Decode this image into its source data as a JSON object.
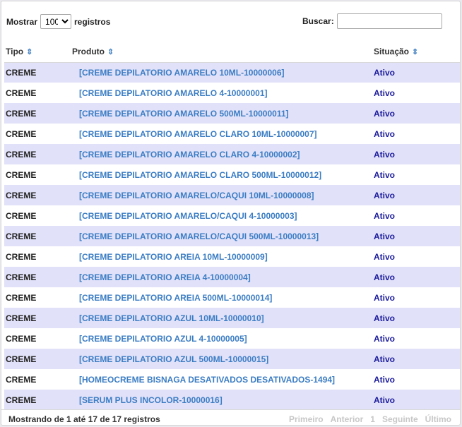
{
  "controls": {
    "show_label": "Mostrar",
    "page_size": "100",
    "records_label": "registros",
    "search_label": "Buscar:",
    "search_value": ""
  },
  "table": {
    "headers": {
      "tipo": "Tipo",
      "produto": "Produto",
      "situacao": "Situação"
    },
    "rows": [
      {
        "tipo": "CREME",
        "produto": "[CREME DEPILATORIO AMARELO 10ML-10000006]",
        "situacao": "Ativo"
      },
      {
        "tipo": "CREME",
        "produto": "[CREME DEPILATORIO AMARELO 4-10000001]",
        "situacao": "Ativo"
      },
      {
        "tipo": "CREME",
        "produto": "[CREME DEPILATORIO AMARELO 500ML-10000011]",
        "situacao": "Ativo"
      },
      {
        "tipo": "CREME",
        "produto": "[CREME DEPILATORIO AMARELO CLARO 10ML-10000007]",
        "situacao": "Ativo"
      },
      {
        "tipo": "CREME",
        "produto": "[CREME DEPILATORIO AMARELO CLARO 4-10000002]",
        "situacao": "Ativo"
      },
      {
        "tipo": "CREME",
        "produto": "[CREME DEPILATORIO AMARELO CLARO 500ML-10000012]",
        "situacao": "Ativo"
      },
      {
        "tipo": "CREME",
        "produto": "[CREME DEPILATORIO AMARELO/CAQUI 10ML-10000008]",
        "situacao": "Ativo"
      },
      {
        "tipo": "CREME",
        "produto": "[CREME DEPILATORIO AMARELO/CAQUI 4-10000003]",
        "situacao": "Ativo"
      },
      {
        "tipo": "CREME",
        "produto": "[CREME DEPILATORIO AMARELO/CAQUI 500ML-10000013]",
        "situacao": "Ativo"
      },
      {
        "tipo": "CREME",
        "produto": "[CREME DEPILATORIO AREIA 10ML-10000009]",
        "situacao": "Ativo"
      },
      {
        "tipo": "CREME",
        "produto": "[CREME DEPILATORIO AREIA 4-10000004]",
        "situacao": "Ativo"
      },
      {
        "tipo": "CREME",
        "produto": "[CREME DEPILATORIO AREIA 500ML-10000014]",
        "situacao": "Ativo"
      },
      {
        "tipo": "CREME",
        "produto": "[CREME DEPILATORIO AZUL 10ML-10000010]",
        "situacao": "Ativo"
      },
      {
        "tipo": "CREME",
        "produto": "[CREME DEPILATORIO AZUL 4-10000005]",
        "situacao": "Ativo"
      },
      {
        "tipo": "CREME",
        "produto": "[CREME DEPILATORIO AZUL 500ML-10000015]",
        "situacao": "Ativo"
      },
      {
        "tipo": "CREME",
        "produto": "[HOMEOCREME BISNAGA DESATIVADOS DESATIVADOS-1494]",
        "situacao": "Ativo"
      },
      {
        "tipo": "CREME",
        "produto": "[SERUM PLUS INCOLOR-10000016]",
        "situacao": "Ativo"
      }
    ]
  },
  "footer": {
    "info": "Mostrando de 1 até 17 de 17 registros",
    "paging": {
      "first": "Primeiro",
      "previous": "Anterior",
      "current": "1",
      "next": "Seguinte",
      "last": "Último"
    }
  },
  "colors": {
    "row_stripe": "#e1e1f9",
    "link": "#3b7dc4",
    "status": "#1a1a9c",
    "sort_icon": "#4a86c5",
    "disabled_paging": "#c7c7c7"
  },
  "icons": {
    "sort": "sort-both-icon",
    "select_arrow": "chevron-down-icon"
  }
}
